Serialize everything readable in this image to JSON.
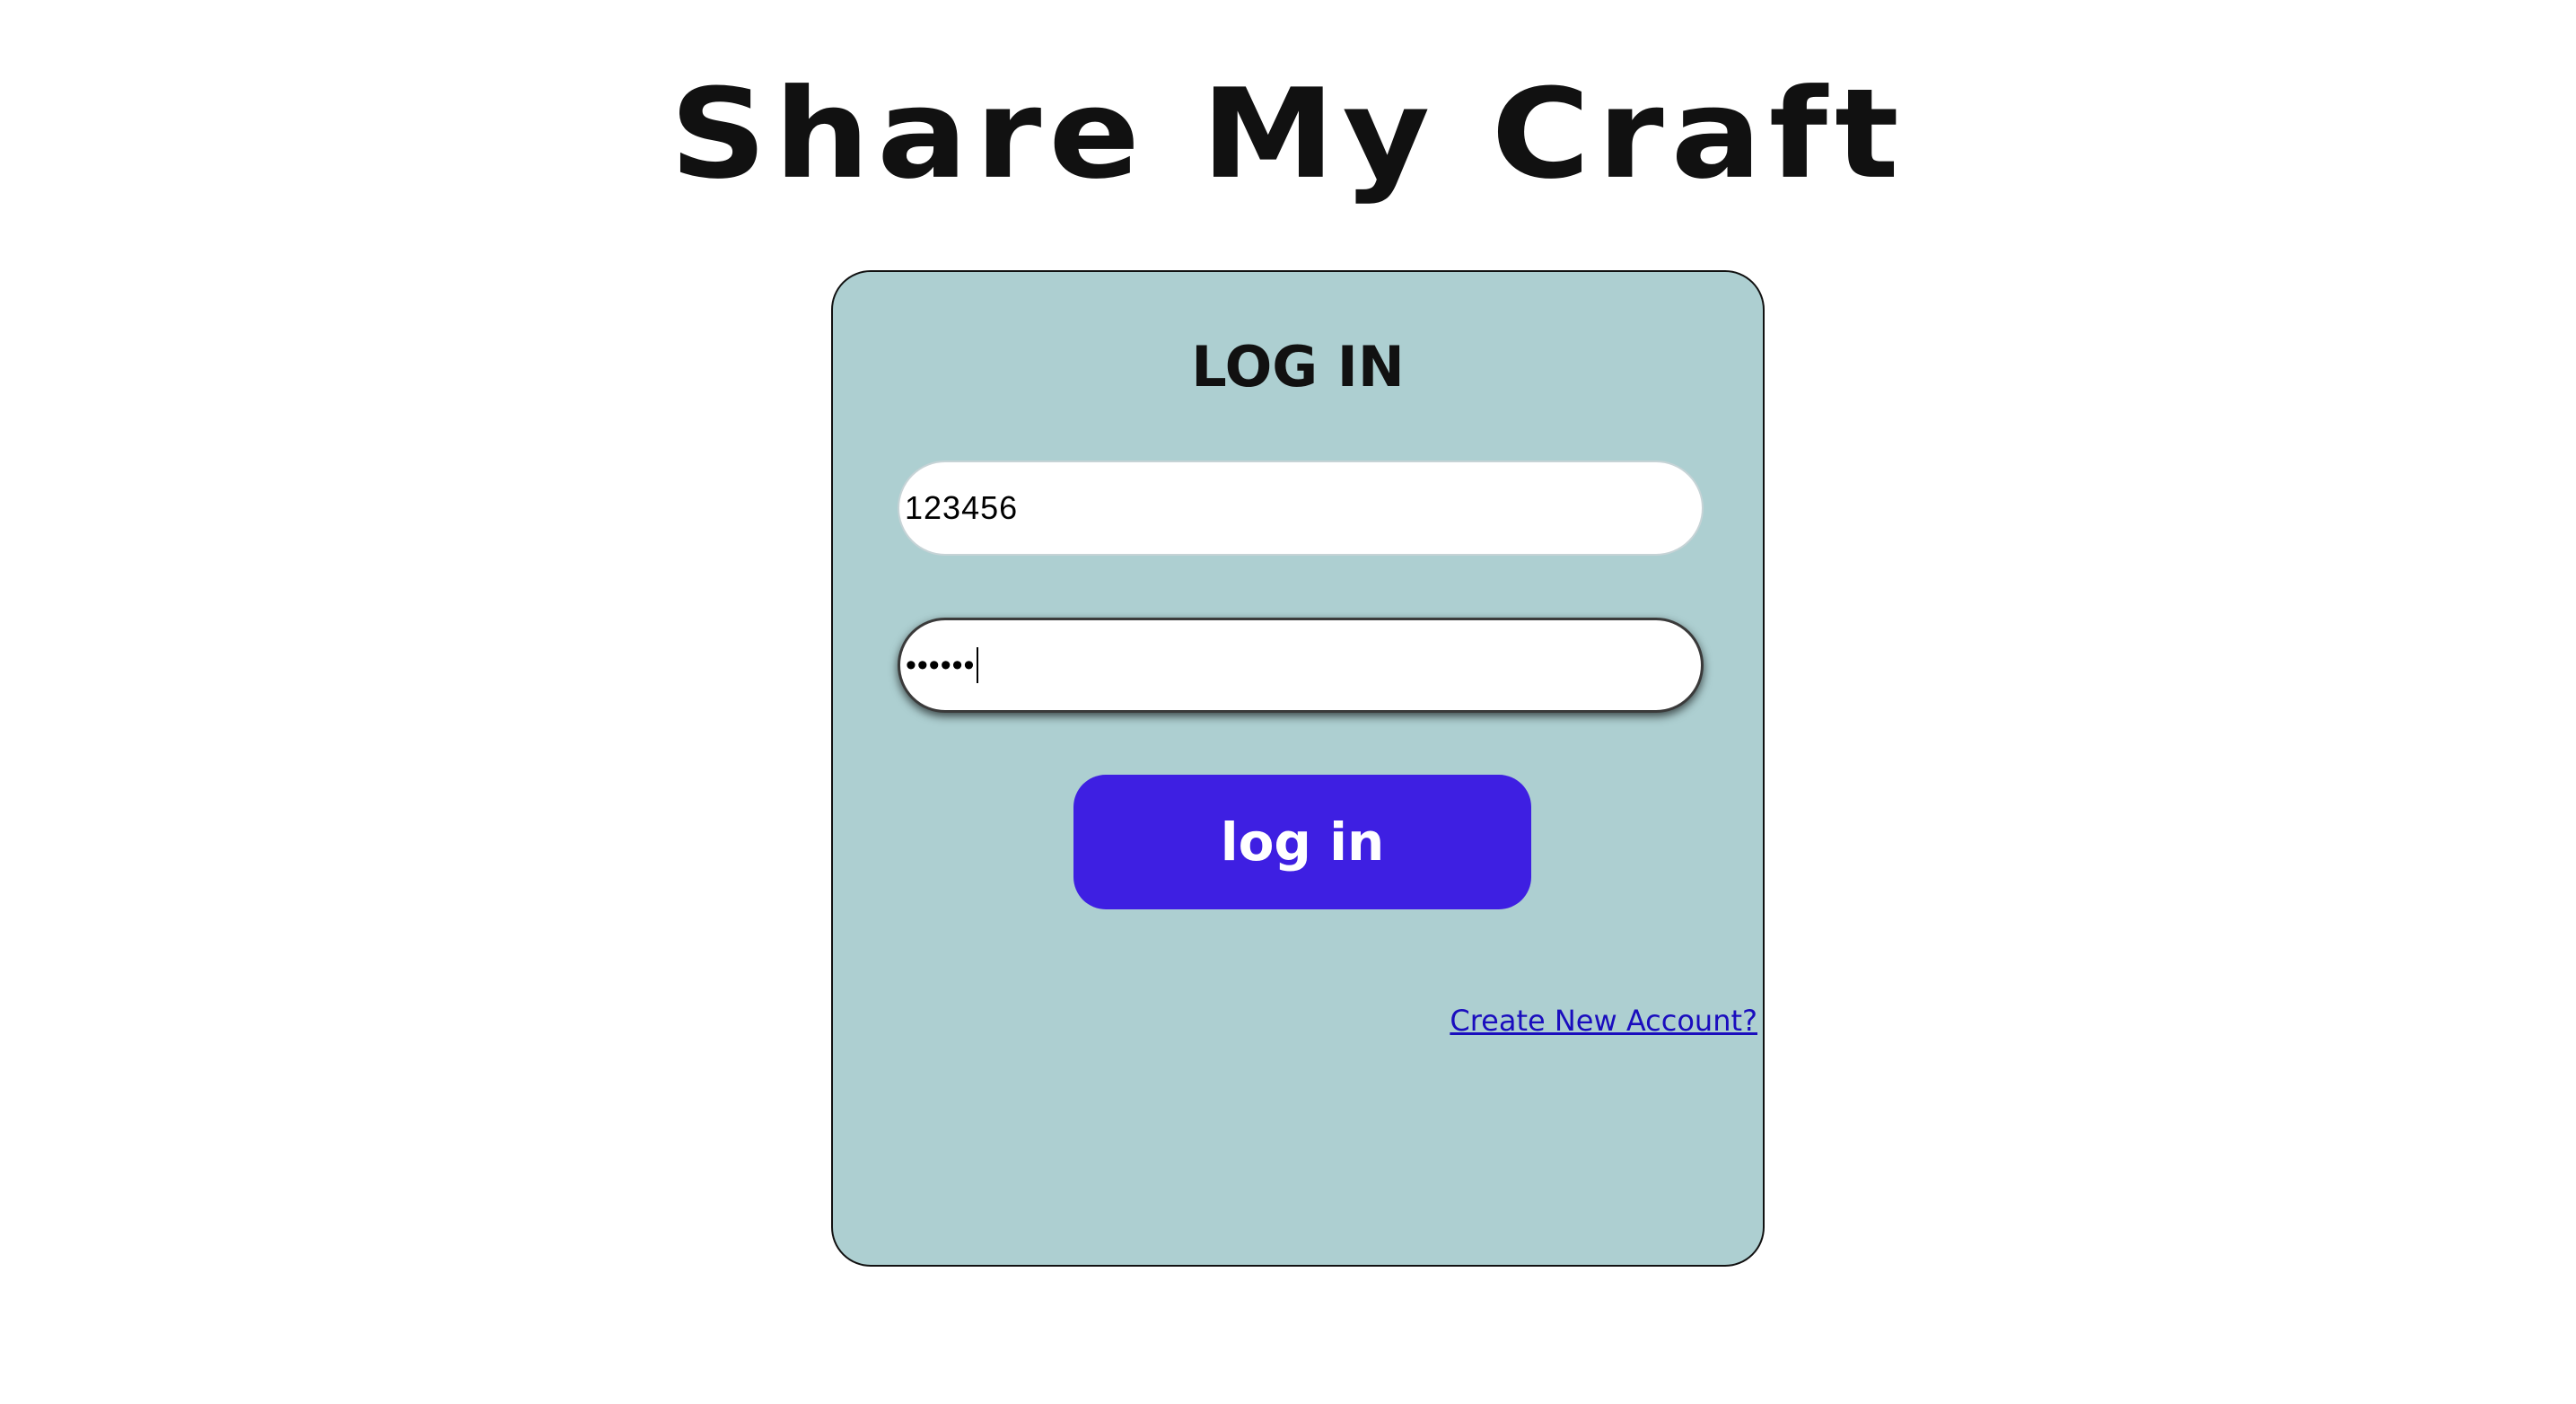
{
  "app": {
    "title": "Share My Craft"
  },
  "login_card": {
    "heading": "LOG IN",
    "username": {
      "value": "123456"
    },
    "password": {
      "masked_value": "••••••"
    },
    "submit_label": "log in",
    "create_account_label": "Create New Account?"
  },
  "colors": {
    "card_background": "#adcfd1",
    "button_background": "#3e1fe2",
    "link": "#1a0dbe"
  }
}
